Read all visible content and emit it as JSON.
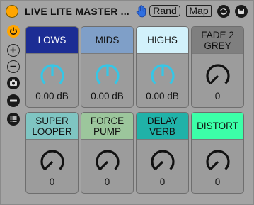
{
  "device": {
    "title": "LIVE LITE MASTER ...",
    "rand_label": "Rand",
    "map_label": "Map",
    "accent_color": "#ffa500"
  },
  "sidebar_icons": [
    "power-icon",
    "plus-icon",
    "minus-icon",
    "camera-icon",
    "dash-icon",
    "list-icon"
  ],
  "macros": [
    {
      "label": "LOWS",
      "header_color": "#1c2d94",
      "label_color": "#ffffff",
      "knob_color": "#35c6e6",
      "value": "0.00 dB",
      "level": 0.5
    },
    {
      "label": "MIDS",
      "header_color": "#7f9fc8",
      "label_color": "#111111",
      "knob_color": "#35c6e6",
      "value": "0.00 dB",
      "level": 0.5
    },
    {
      "label": "HIGHS",
      "header_color": "#d2f1fb",
      "label_color": "#111111",
      "knob_color": "#35c6e6",
      "value": "0.00 dB",
      "level": 0.5
    },
    {
      "label": "FADE 2\nGREY",
      "header_color": "#7f7f7f",
      "label_color": "#111111",
      "knob_color": "#111111",
      "value": "0",
      "level": 0.0
    },
    {
      "label": "SUPER\nLOOPER",
      "header_color": "#7fc5c2",
      "label_color": "#111111",
      "knob_color": "#111111",
      "value": "0",
      "level": 0.0
    },
    {
      "label": "FORCE\nPUMP",
      "header_color": "#9cc69c",
      "label_color": "#111111",
      "knob_color": "#111111",
      "value": "0",
      "level": 0.0
    },
    {
      "label": "DELAY\nVERB",
      "header_color": "#20b2a8",
      "label_color": "#111111",
      "knob_color": "#111111",
      "value": "0",
      "level": 0.0
    },
    {
      "label": "DISTORT",
      "header_color": "#3cffa8",
      "label_color": "#111111",
      "knob_color": "#111111",
      "value": "0",
      "level": 0.0
    }
  ]
}
